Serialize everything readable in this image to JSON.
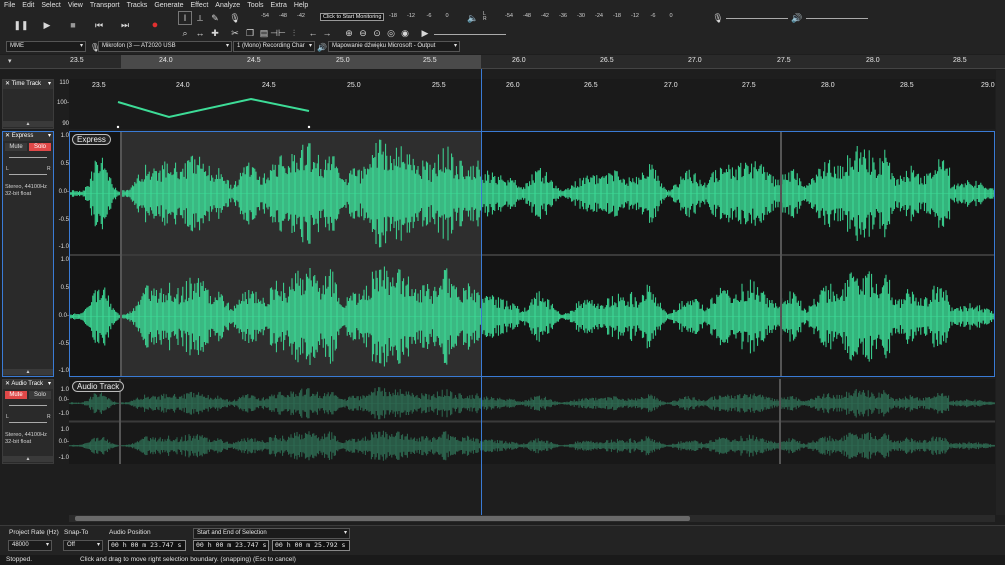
{
  "menu": [
    "File",
    "Edit",
    "Select",
    "View",
    "Transport",
    "Tracks",
    "Generate",
    "Effect",
    "Analyze",
    "Tools",
    "Extra",
    "Help"
  ],
  "transport": {
    "pause_icon": "pause-icon",
    "play_icon": "play-icon",
    "stop_icon": "stop-icon",
    "skip_start_icon": "skip-start-icon",
    "skip_end_icon": "skip-end-icon",
    "record_icon": "record-icon",
    "record_color": "#e03030"
  },
  "meters": {
    "record_scale": [
      "-54",
      "-48",
      "-42"
    ],
    "monitor_label": "Click to Start Monitoring",
    "record_scale_right": [
      "-18",
      "-12",
      "-6",
      "0"
    ],
    "play_scale": [
      "-54",
      "-48",
      "-42",
      "-36",
      "-30",
      "-24",
      "-18",
      "-12",
      "-6",
      "0"
    ],
    "lr_left": "L",
    "lr_right": "R"
  },
  "devices": {
    "host": "MME",
    "mic": "Mikrofon (3 — AT2020 USB",
    "channels": "1 (Mono) Recording Char",
    "output": "Mapowanie dźwięku Microsoft - Output"
  },
  "timeline": {
    "ticks": [
      "23.5",
      "24.0",
      "24.5",
      "25.0",
      "25.5",
      "26.0",
      "26.5",
      "27.0",
      "27.5",
      "28.0",
      "28.5"
    ],
    "track_ticks": [
      "23.5",
      "24.0",
      "24.5",
      "25.0",
      "25.5",
      "26.0",
      "26.5",
      "27.0",
      "27.5",
      "28.0",
      "28.5",
      "29.0"
    ]
  },
  "time_track": {
    "name": "Time Track",
    "scale": [
      "110",
      "100-",
      "90"
    ]
  },
  "express_track": {
    "name": "Express",
    "clip_label": "Express",
    "mute": "Mute",
    "solo": "Solo",
    "info1": "Stereo, 44100Hz",
    "info2": "32-bit float",
    "scale": [
      "1.0",
      "0.5",
      "0.0-",
      "-0.5",
      "-1.0"
    ],
    "gain_l": "L",
    "gain_r": "R",
    "wave_color": "#3ddc97"
  },
  "audio_track": {
    "name": "Audio Track",
    "clip_label": "Audio Track",
    "mute": "Mute",
    "solo": "Solo",
    "info1": "Stereo, 44100Hz",
    "info2": "32-bit float",
    "scale": [
      "1.0",
      "0.0-",
      "-1.0"
    ],
    "gain_l": "L",
    "gain_r": "R",
    "wave_color": "#2e6b52"
  },
  "bottom": {
    "project_rate_label": "Project Rate (Hz)",
    "project_rate": "48000",
    "snap_label": "Snap-To",
    "snap": "Off",
    "audio_pos_label": "Audio Position",
    "audio_pos": "00 h 00 m 23.747 s",
    "selection_label": "Start and End of Selection",
    "sel_start": "00 h 00 m 23.747 s",
    "sel_end": "00 h 00 m 25.792 s"
  },
  "status": {
    "state": "Stopped.",
    "message": "Click and drag to move right selection boundary. (snapping) (Esc to cancel)"
  }
}
